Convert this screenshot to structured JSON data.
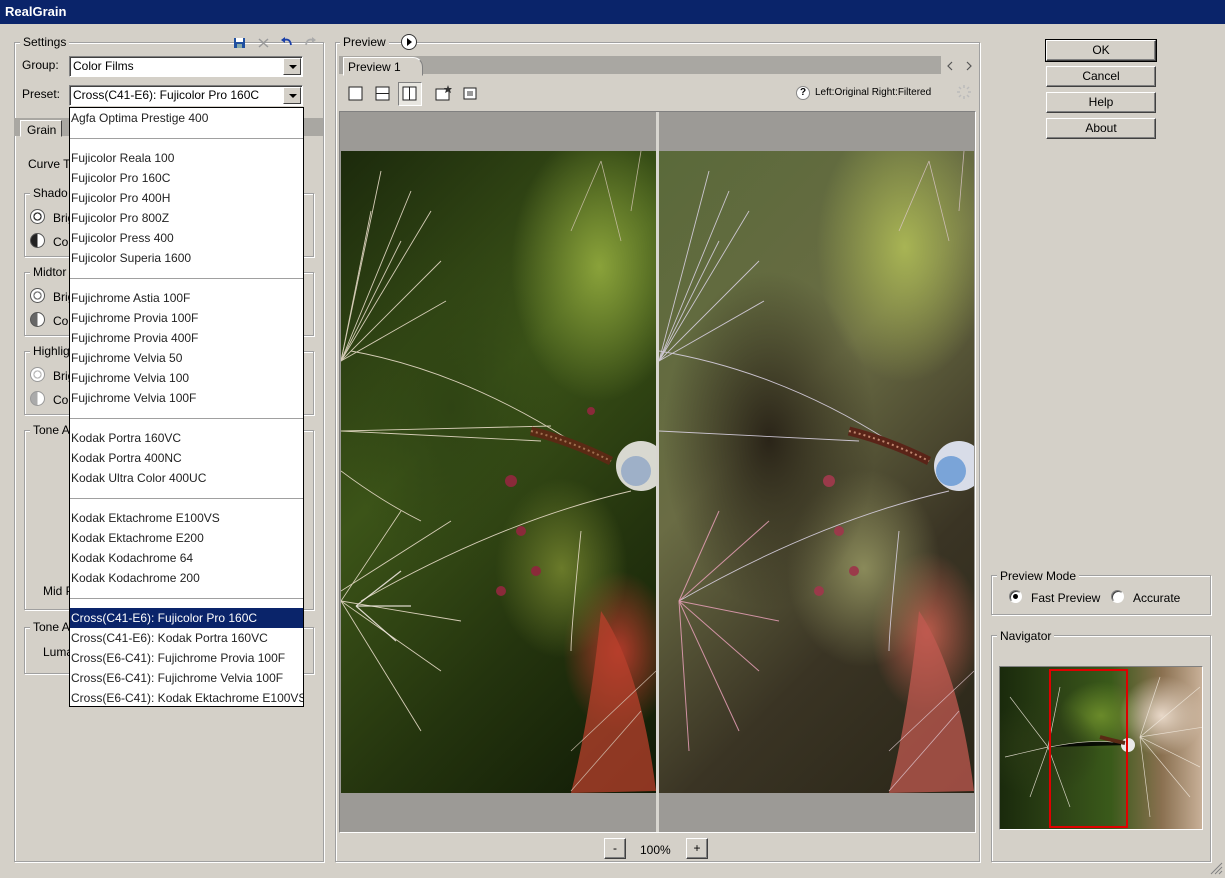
{
  "window": {
    "title": "RealGrain"
  },
  "settings": {
    "title": "Settings",
    "group_label": "Group:",
    "group_value": "Color Films",
    "preset_label": "Preset:",
    "preset_value": "Cross(C41-E6): Fujicolor Pro 160C",
    "tabs": [
      "Grain"
    ],
    "curve_label": "Curve T",
    "shadows_title": "Shado",
    "midtones_title": "Midtor",
    "highlights_title": "Highlig",
    "brightness_short": "Brig",
    "contrast_short": "Co",
    "contrast_short_alt": "Cor",
    "tone_title_1": "Tone A",
    "mid_label": "Mid P",
    "tone_title_2": "Tone A",
    "luma_label": "Luma"
  },
  "dropdown": {
    "groups": [
      [
        "Agfa Optima Prestige 400"
      ],
      [
        "Fujicolor Reala 100",
        "Fujicolor Pro 160C",
        "Fujicolor Pro 400H",
        "Fujicolor Pro 800Z",
        "Fujicolor Press 400",
        "Fujicolor Superia 1600"
      ],
      [
        "Fujichrome Astia 100F",
        "Fujichrome Provia 100F",
        "Fujichrome Provia 400F",
        "Fujichrome Velvia 50",
        "Fujichrome Velvia 100",
        "Fujichrome Velvia 100F"
      ],
      [
        "Kodak Portra 160VC",
        "Kodak Portra 400NC",
        "Kodak Ultra Color 400UC"
      ],
      [
        "Kodak Ektachrome E100VS",
        "Kodak Ektachrome E200",
        "Kodak Kodachrome 64",
        "Kodak Kodachrome 200"
      ],
      [
        "Cross(C41-E6): Fujicolor Pro 160C",
        "Cross(C41-E6): Kodak Portra 160VC",
        "Cross(E6-C41): Fujichrome Provia 100F",
        "Cross(E6-C41): Fujichrome Velvia 100F",
        "Cross(E6-C41): Kodak Ektachrome E100VS"
      ]
    ],
    "selected": "Cross(C41-E6): Fujicolor Pro 160C"
  },
  "preview": {
    "title": "Preview",
    "tab_label": "Preview 1",
    "compare_text": "Left:Original Right:Filtered",
    "help_glyph": "?",
    "zoom": "100%",
    "zoom_out": "-",
    "zoom_in": "+"
  },
  "buttons": {
    "ok": "OK",
    "cancel": "Cancel",
    "help": "Help",
    "about": "About"
  },
  "preview_mode": {
    "title": "Preview Mode",
    "fast": "Fast Preview",
    "accurate": "Accurate",
    "selected": "fast"
  },
  "navigator": {
    "title": "Navigator"
  },
  "colors": {
    "title_bar": "#0a246a",
    "selection": "#0a246a",
    "navigator_frame": "#e00000",
    "canvas_grey": "#9c9a96"
  }
}
